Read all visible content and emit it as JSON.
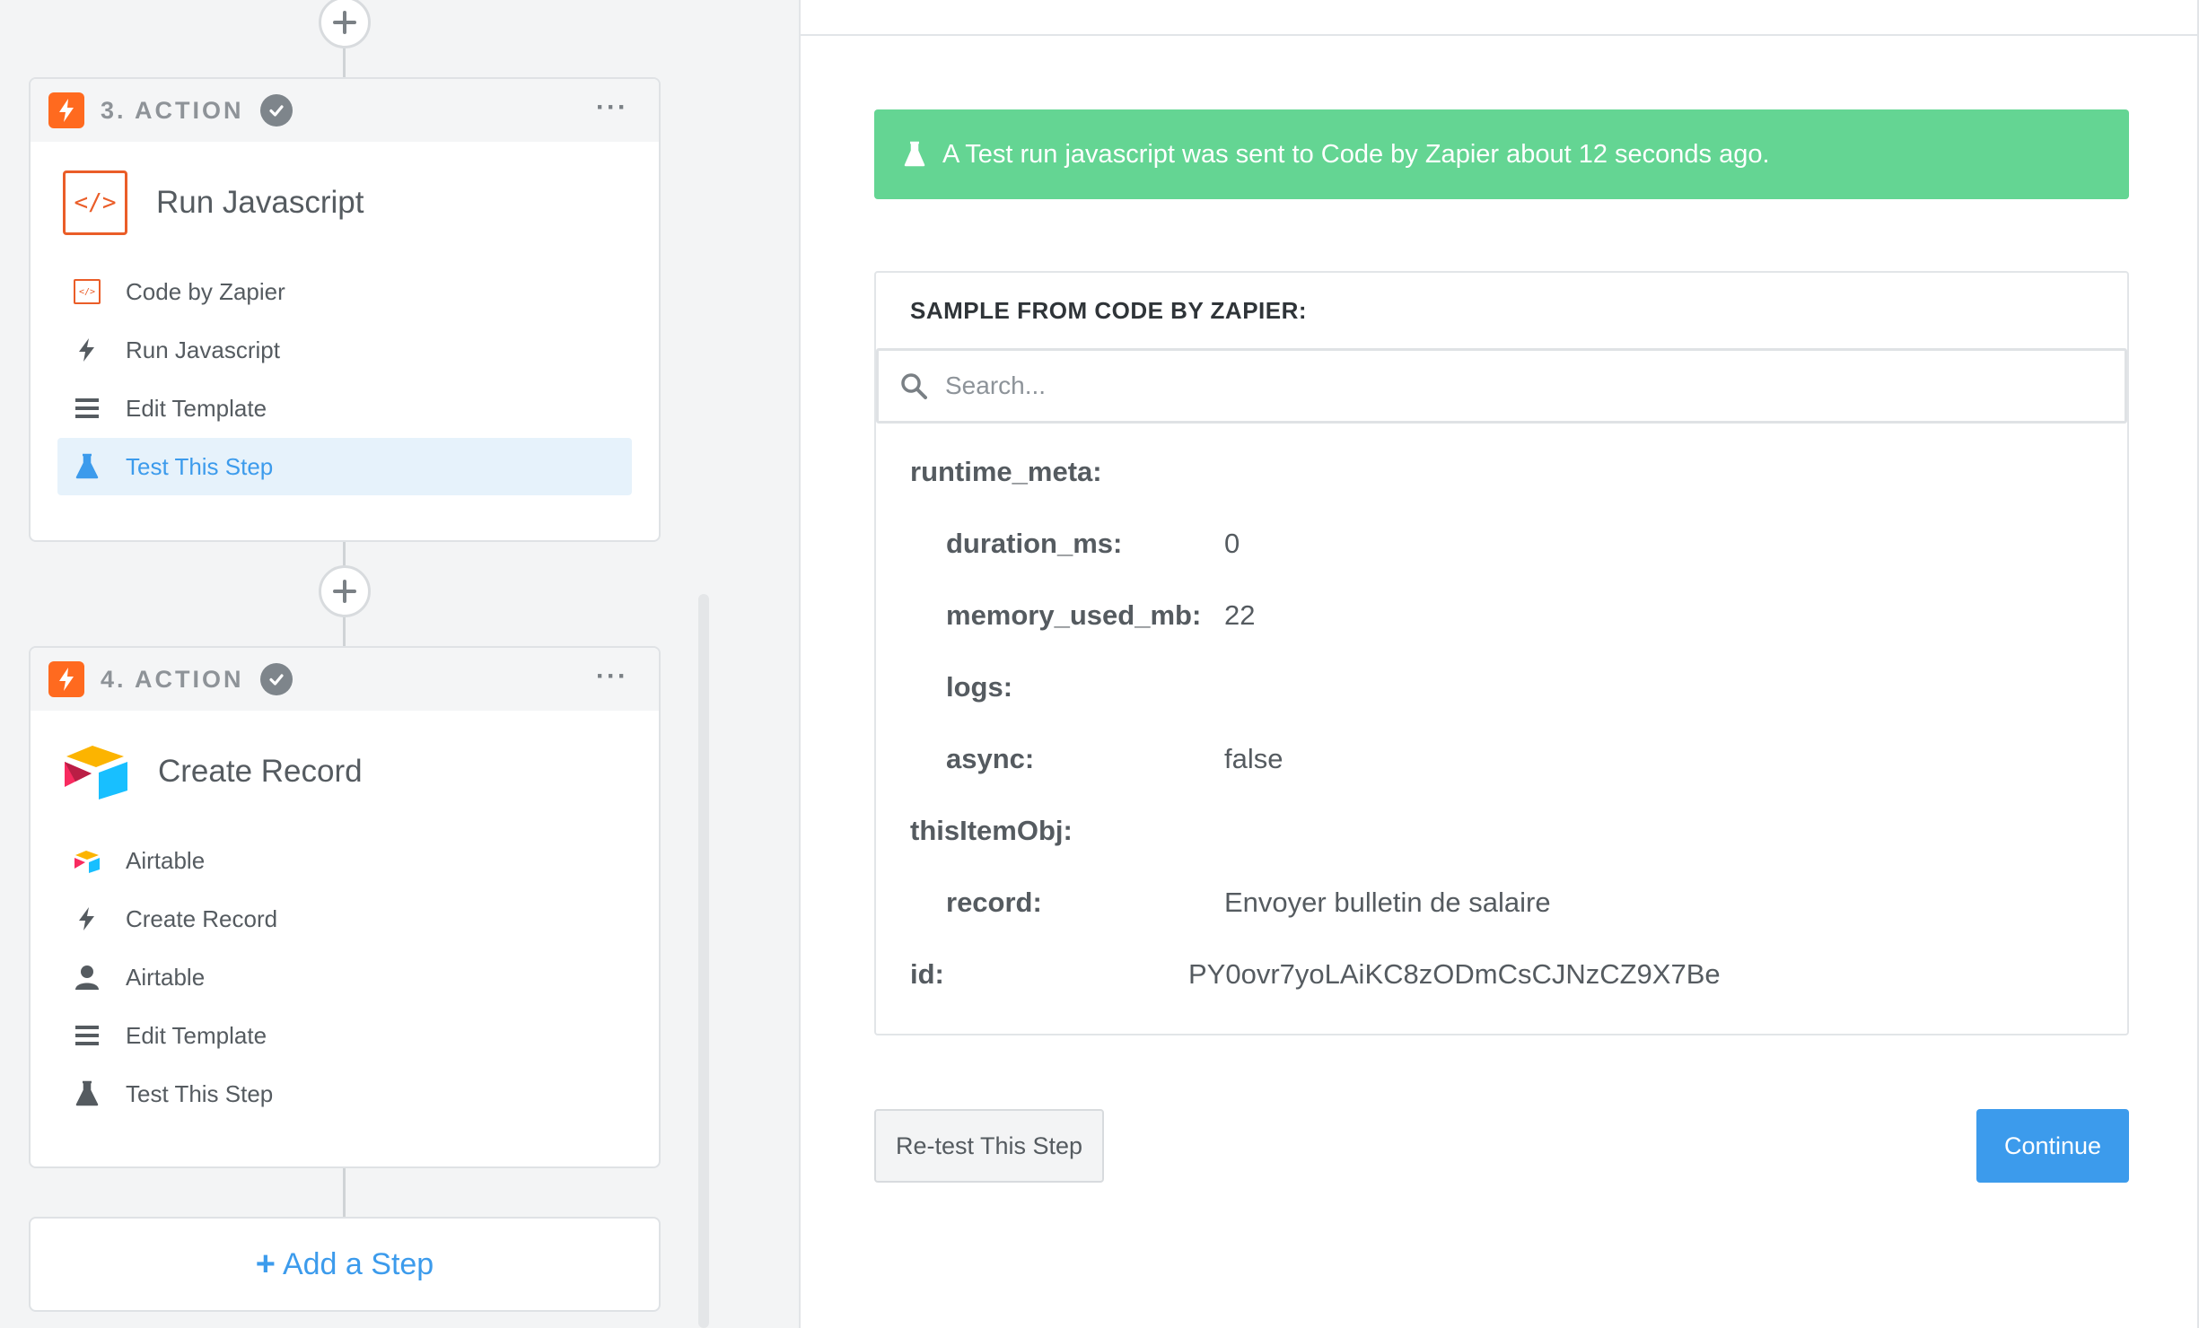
{
  "steps": [
    {
      "title": "3. ACTION",
      "app_title": "Run Javascript",
      "menu": [
        {
          "label": "Code by Zapier",
          "icon": "code-icon"
        },
        {
          "label": "Run Javascript",
          "icon": "bolt-icon"
        },
        {
          "label": "Edit Template",
          "icon": "lines-icon"
        },
        {
          "label": "Test This Step",
          "icon": "flask-icon",
          "active": true
        }
      ]
    },
    {
      "title": "4. ACTION",
      "app_title": "Create Record",
      "menu": [
        {
          "label": "Airtable",
          "icon": "airtable-icon"
        },
        {
          "label": "Create Record",
          "icon": "bolt-icon"
        },
        {
          "label": "Airtable",
          "icon": "user-icon"
        },
        {
          "label": "Edit Template",
          "icon": "lines-icon"
        },
        {
          "label": "Test This Step",
          "icon": "flask-icon"
        }
      ]
    }
  ],
  "add_step": {
    "plus": "+",
    "label": "Add a Step"
  },
  "alert": {
    "text": "A Test run javascript was sent to Code by Zapier about 12 seconds ago."
  },
  "sample": {
    "header": "SAMPLE FROM CODE BY ZAPIER:",
    "search_placeholder": "Search...",
    "fields": {
      "runtime_meta": "runtime_meta:",
      "duration_ms": {
        "key": "duration_ms:",
        "value": "0"
      },
      "memory_used_mb": {
        "key": "memory_used_mb:",
        "value": "22"
      },
      "logs": {
        "key": "logs:",
        "value": ""
      },
      "async": {
        "key": "async:",
        "value": "false"
      },
      "thisItemObj": "thisItemObj:",
      "record": {
        "key": "record:",
        "value": "Envoyer bulletin de salaire"
      },
      "id": {
        "key": "id:",
        "value": "PY0ovr7yoLAiKC8zODmCsCJNzCZ9X7Be"
      }
    }
  },
  "buttons": {
    "retest": "Re-test This Step",
    "continue": "Continue"
  },
  "colors": {
    "accent": "#3c9bec",
    "success": "#64d593",
    "zapier_orange": "#ff6a1f",
    "code_orange": "#ea5d28"
  }
}
